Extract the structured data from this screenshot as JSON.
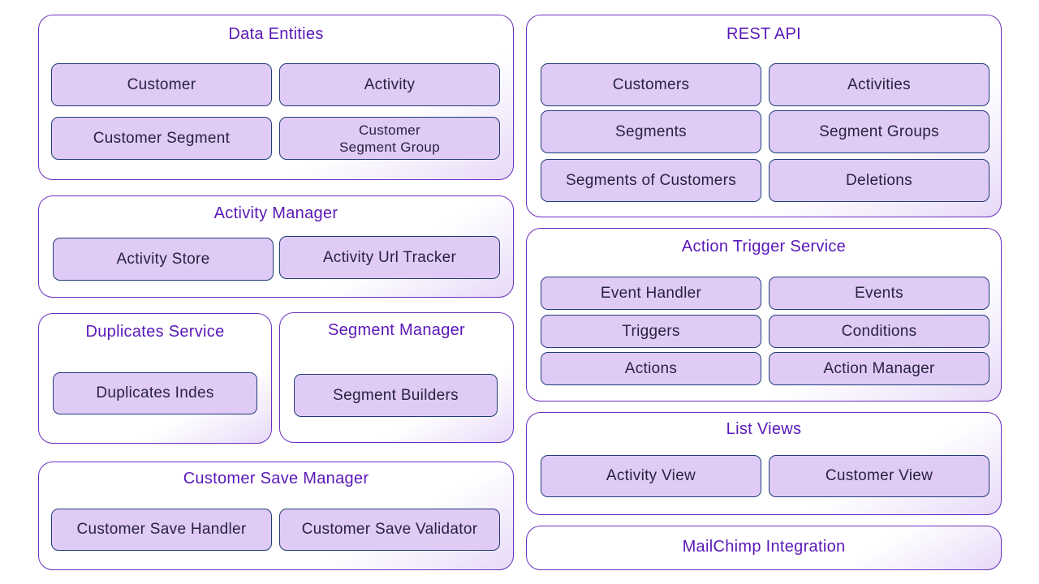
{
  "colors": {
    "group_border": "#6a2fc0",
    "group_title": "#5a18b8",
    "box_fill": "#dfcbf5",
    "box_border": "#1f3c78",
    "box_text": "#2a2340"
  },
  "groups": {
    "data_entities": {
      "title": "Data Entities",
      "items": [
        "Customer",
        "Activity",
        "Customer Segment",
        "Customer\nSegment Group"
      ]
    },
    "activity_manager": {
      "title": "Activity Manager",
      "items": [
        "Activity Store",
        "Activity Url Tracker"
      ]
    },
    "duplicates_service": {
      "title": "Duplicates Service",
      "items": [
        "Duplicates Indes"
      ]
    },
    "segment_manager": {
      "title": "Segment Manager",
      "items": [
        "Segment Builders"
      ]
    },
    "customer_save_manager": {
      "title": "Customer Save Manager",
      "items": [
        "Customer Save Handler",
        "Customer Save Validator"
      ]
    },
    "rest_api": {
      "title": "REST API",
      "items": [
        "Customers",
        "Activities",
        "Segments",
        "Segment Groups",
        "Segments of Customers",
        "Deletions"
      ]
    },
    "action_trigger_service": {
      "title": "Action Trigger Service",
      "items": [
        "Event Handler",
        "Events",
        "Triggers",
        "Conditions",
        "Actions",
        "Action Manager"
      ]
    },
    "list_views": {
      "title": "List Views",
      "items": [
        "Activity View",
        "Customer View"
      ]
    },
    "mailchimp_integration": {
      "title": "MailChimp Integration"
    }
  }
}
